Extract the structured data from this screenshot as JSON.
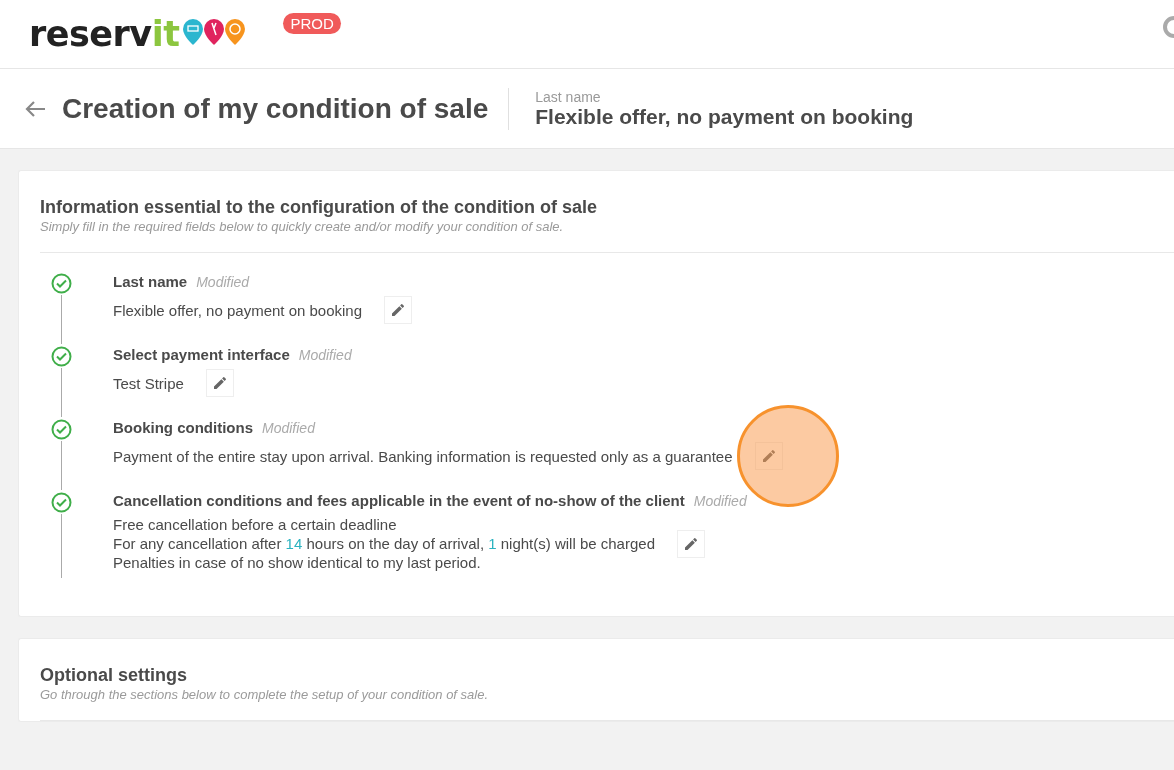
{
  "header": {
    "logo": {
      "text": "reserv",
      "accent": "it"
    },
    "badge": "PROD"
  },
  "title_bar": {
    "title": "Creation of my condition of sale",
    "field_label": "Last name",
    "field_value": "Flexible offer, no payment on booking"
  },
  "essential": {
    "title": "Information essential to the configuration of the condition of sale",
    "subtitle": "Simply fill in the required fields below to quickly create and/or modify your condition of sale.",
    "steps": [
      {
        "label": "Last name",
        "status": "Modified",
        "done": true,
        "highlighted": false,
        "lines": [
          [
            {
              "text": "Flexible offer, no payment on booking",
              "accent": false
            }
          ]
        ]
      },
      {
        "label": "Select payment interface",
        "status": "Modified",
        "done": true,
        "highlighted": false,
        "lines": [
          [
            {
              "text": "Test Stripe",
              "accent": false
            }
          ]
        ]
      },
      {
        "label": "Booking conditions",
        "status": "Modified",
        "done": true,
        "highlighted": true,
        "lines": [
          [
            {
              "text": "Payment of the entire stay upon arrival. Banking information is requested only as a guarantee",
              "accent": false
            }
          ]
        ]
      },
      {
        "label": "Cancellation conditions and fees applicable in the event of no-show of the client",
        "status": "Modified",
        "done": true,
        "highlighted": false,
        "lines": [
          [
            {
              "text": "Free cancellation before a certain deadline",
              "accent": false
            }
          ],
          [
            {
              "text": "For any cancellation after ",
              "accent": false
            },
            {
              "text": "14",
              "accent": true
            },
            {
              "text": " hours on the day of arrival, ",
              "accent": false
            },
            {
              "text": "1",
              "accent": true
            },
            {
              "text": " night(s) will be charged",
              "accent": false
            }
          ],
          [
            {
              "text": "Penalties in case of no show identical to my last period.",
              "accent": false
            }
          ]
        ]
      }
    ]
  },
  "optional": {
    "title": "Optional settings",
    "subtitle": "Go through the sections below to complete the setup of your condition of sale."
  }
}
